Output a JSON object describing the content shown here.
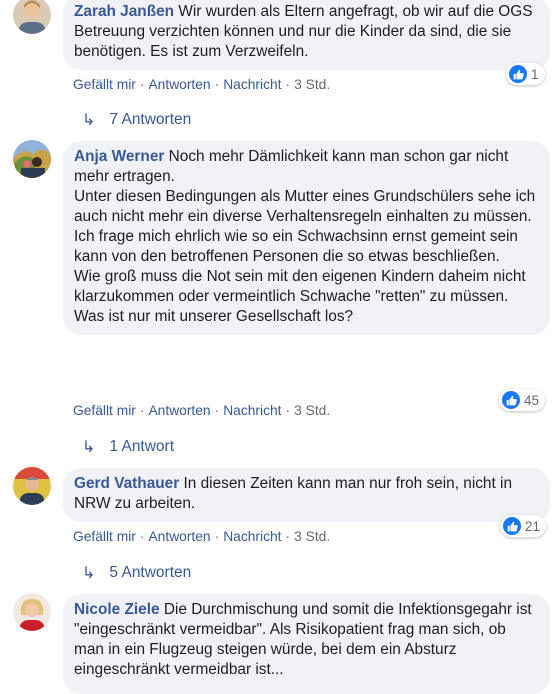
{
  "colors": {
    "link": "#385898",
    "bubble": "#f0f2f5",
    "meta": "#65676b",
    "like": "#1877f2"
  },
  "actions": {
    "like": "Gefällt mir",
    "reply": "Antworten",
    "message": "Nachricht",
    "sep": "·"
  },
  "reply_icon": "reply-arrow-icon",
  "comments": [
    {
      "author": "Zarah Janßen",
      "lines": [
        " Wir wurden als Eltern angefragt, ob wir auf die OGS Betreuung verzichten können und nur die Kinder da sind, die sie benötigen. Es ist zum Verzweifeln."
      ],
      "time": "3 Std.",
      "likes": "1",
      "replies": "7 Antworten"
    },
    {
      "author": "Anja Werner",
      "lines": [
        " Noch mehr Dämlichkeit kann man schon gar nicht mehr ertragen.",
        "Unter diesen Bedingungen als Mutter eines Grundschülers sehe ich auch nicht mehr ein diverse Verhaltensregeln einhalten zu müssen.",
        "Ich frage mich ehrlich wie so ein Schwachsinn ernst gemeint sein kann von den betroffenen Personen die so etwas beschließen.",
        "Wie groß muss die Not sein mit den eigenen Kindern daheim nicht klarzukommen oder vermeintlich Schwache \"retten\" zu müssen.",
        "Was ist nur mit unserer Gesellschaft los?"
      ],
      "time": "3 Std.",
      "likes": "45",
      "replies": "1 Antwort"
    },
    {
      "author": "Gerd Vathauer",
      "lines": [
        " In diesen Zeiten kann man nur froh sein, nicht in NRW zu arbeiten."
      ],
      "time": "3 Std.",
      "likes": "21",
      "replies": "5 Antworten"
    },
    {
      "author": "Nicole Ziele",
      "lines": [
        " Die Durchmischung und somit die Infektionsgegahr ist \"eingeschränkt vermeidbar\". Als Risikopatient frag man sich, ob man in ein Flugzeug steigen würde, bei dem ein Absturz eingeschränkt vermeidbar ist..."
      ],
      "time": "",
      "likes": "",
      "replies": ""
    }
  ]
}
